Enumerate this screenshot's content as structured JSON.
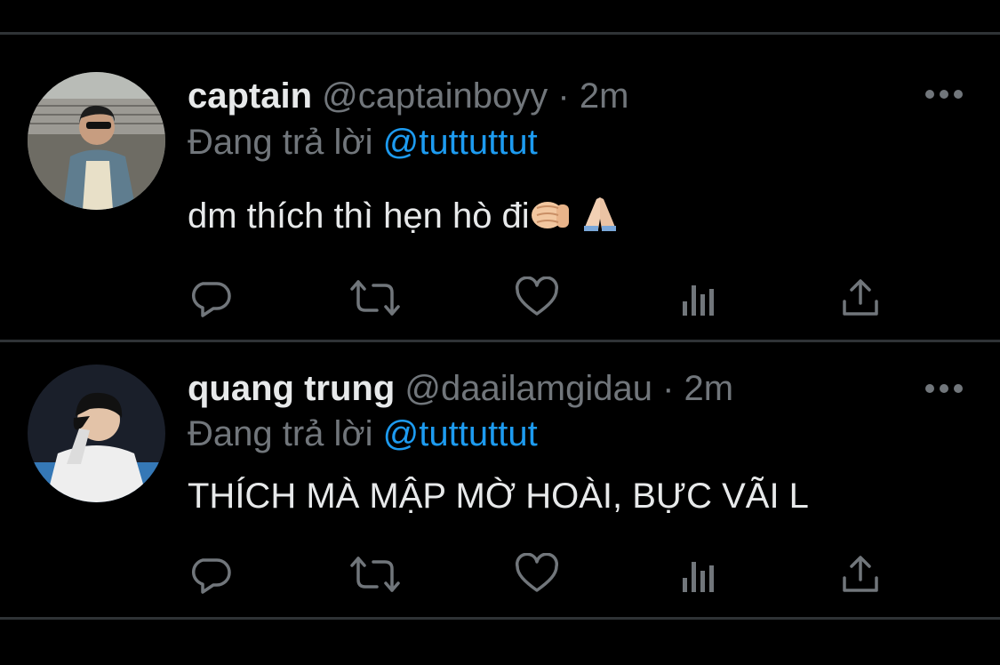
{
  "tweets": [
    {
      "display_name": "captain",
      "handle": "@captainboyy",
      "separator": "·",
      "time": "2m",
      "reply_prefix": "Đang trả lời",
      "reply_to": "@tuttuttut",
      "text": "dm thích thì hẹn hò đi",
      "emojis": [
        "fist-bump-emoji",
        "folded-hands-emoji"
      ],
      "avatar": "avatar-captain"
    },
    {
      "display_name": "quang trung",
      "handle": "@daailamgidau",
      "separator": "·",
      "time": "2m",
      "reply_prefix": "Đang trả lời",
      "reply_to": "@tuttuttut",
      "text": "THÍCH MÀ MẬP MỜ HOÀI, BỰC VÃI L",
      "emojis": [],
      "avatar": "avatar-quang-trung"
    }
  ],
  "actions": [
    "reply-icon",
    "retweet-icon",
    "like-icon",
    "analytics-icon",
    "share-icon"
  ],
  "colors": {
    "background": "#000000",
    "text": "#e7e9ea",
    "secondary": "#71767b",
    "mention": "#1d9bf0",
    "divider": "#2f3336"
  }
}
